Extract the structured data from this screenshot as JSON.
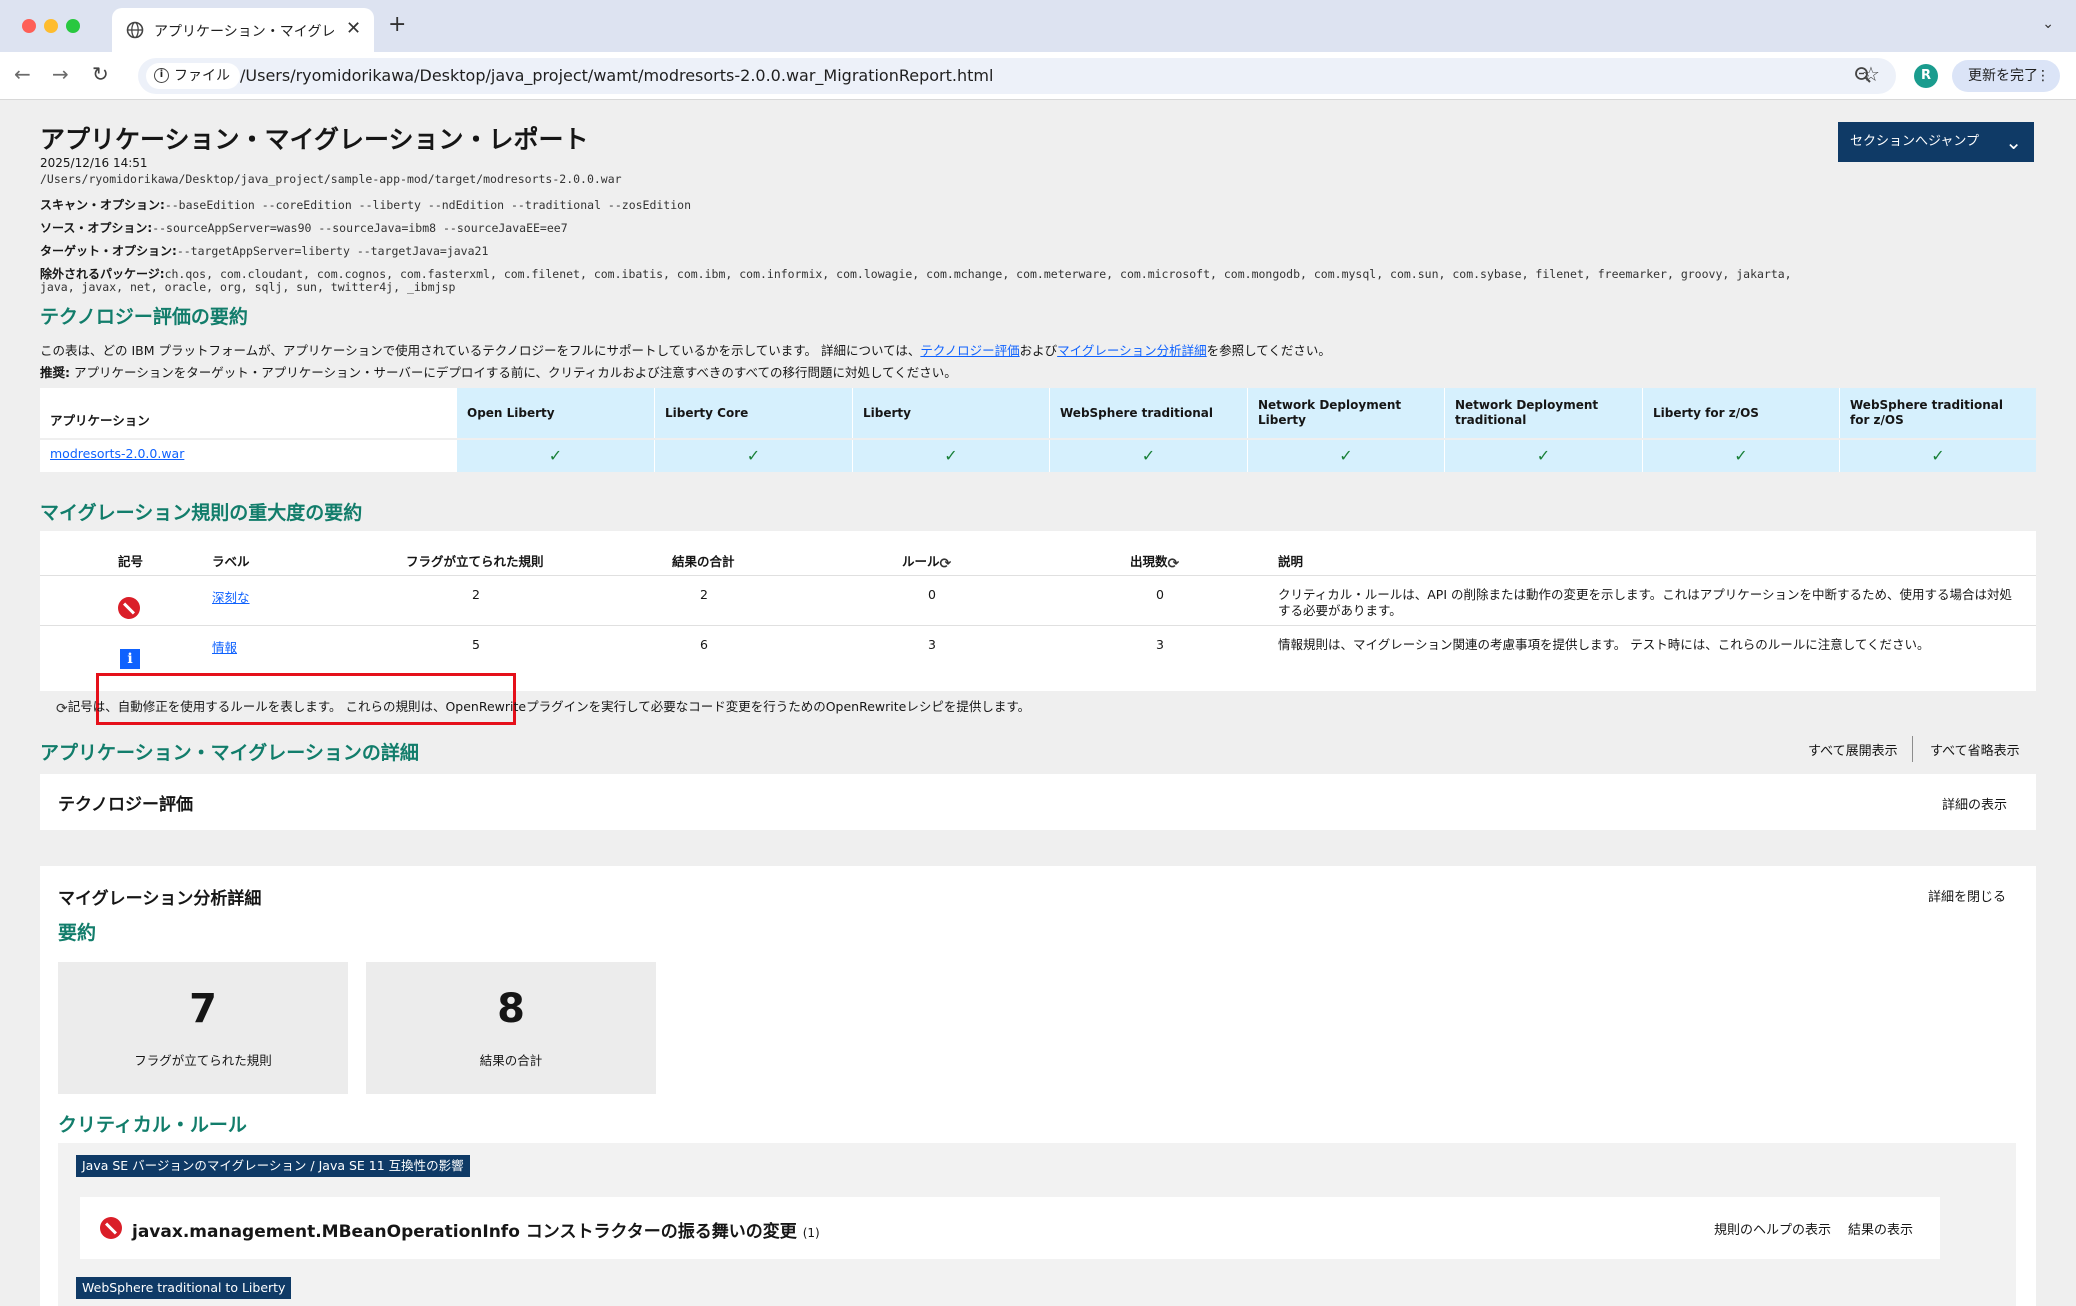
{
  "browser": {
    "tab_title": "アプリケーション・マイグレーシ",
    "url_scheme_label": "ファイル",
    "url": "/Users/ryomidorikawa/Desktop/java_project/wamt/modresorts-2.0.0.war_MigrationReport.html",
    "profile_initial": "R",
    "update_label": "更新を完了"
  },
  "report": {
    "title": "アプリケーション・マイグレーション・レポート",
    "jump_label": "セクションへジャンプ",
    "date": "2025/12/16 14:51",
    "path": "/Users/ryomidorikawa/Desktop/java_project/sample-app-mod/target/modresorts-2.0.0.war",
    "scan_options_label": "スキャン・オプション:",
    "scan_options": "--baseEdition --coreEdition --liberty --ndEdition --traditional --zosEdition",
    "source_options_label": "ソース・オプション:",
    "source_options": "--sourceAppServer=was90 --sourceJava=ibm8 --sourceJavaEE=ee7",
    "target_options_label": "ターゲット・オプション:",
    "target_options": "--targetAppServer=liberty --targetJava=java21",
    "excluded_label": "除外されるパッケージ:",
    "excluded_line1": "ch.qos, com.cloudant, com.cognos, com.fasterxml, com.filenet, com.ibatis, com.ibm, com.informix, com.lowagie, com.mchange, com.meterware, com.microsoft, com.mongodb, com.mysql, com.sun, com.sybase, filenet, freemarker, groovy, jakarta,",
    "excluded_line2": "java, javax, net, oracle, org, sqlj, sun, twitter4j, _ibmjsp"
  },
  "tech_summary": {
    "heading": "テクノロジー評価の要約",
    "desc_prefix": "この表は、どの IBM プラットフォームが、アプリケーションで使用されているテクノロジーをフルにサポートしているかを示しています。 詳細については、",
    "desc_link1": "テクノロジー評価",
    "desc_mid": "および",
    "desc_link2": "マイグレーション分析詳細",
    "desc_suffix": "を参照してください。",
    "reco_label": "推奨:",
    "reco_text": " アプリケーションをターゲット・アプリケーション・サーバーにデプロイする前に、クリティカルおよび注意すべきのすべての移行問題に対処してください。",
    "app_header": "アプリケーション",
    "app_name": "modresorts-2.0.0.war",
    "platforms": [
      {
        "name": "Open Liberty",
        "check": "✓"
      },
      {
        "name": "Liberty Core",
        "check": "✓"
      },
      {
        "name": "Liberty",
        "check": "✓"
      },
      {
        "name": "WebSphere traditional",
        "check": "✓"
      },
      {
        "name": "Network Deployment Liberty",
        "check": "✓"
      },
      {
        "name": "Network Deployment traditional",
        "check": "✓"
      },
      {
        "name": "Liberty for z/OS",
        "check": "✓"
      },
      {
        "name": "WebSphere traditional for z/OS",
        "check": "✓"
      }
    ]
  },
  "severity": {
    "heading": "マイグレーション規則の重大度の要約",
    "headers": {
      "symbol": "記号",
      "label": "ラベル",
      "flagged": "フラグが立てられた規則",
      "total": "結果の合計",
      "rules": "ルール",
      "occurrences": "出現数",
      "description": "説明"
    },
    "rows": [
      {
        "label": "深刻な",
        "flagged": "2",
        "total": "2",
        "rules": "0",
        "occurrences": "0",
        "description": "クリティカル・ルールは、API の削除または動作の変更を示します。これはアプリケーションを中断するため、使用する場合は対処する必要があります。"
      },
      {
        "label": "情報",
        "flagged": "5",
        "total": "6",
        "rules": "3",
        "occurrences": "3",
        "description": "情報規則は、マイグレーション関連の考慮事項を提供します。 テスト時には、これらのルールに注意してください。"
      }
    ],
    "autofix_note": "記号は、自動修正を使用するルールを表します。 これらの規則は、OpenRewriteプラグインを実行して必要なコード変更を行うためのOpenRewriteレシピを提供します。"
  },
  "details": {
    "heading": "アプリケーション・マイグレーションの詳細",
    "expand_all": "すべて展開表示",
    "collapse_all": "すべて省略表示",
    "tech_eval_title": "テクノロジー評価",
    "tech_eval_link": "詳細の表示",
    "analysis_title": "マイグレーション分析詳細",
    "analysis_link": "詳細を閉じる",
    "summary_heading": "要約",
    "stats": [
      {
        "value": "7",
        "label": "フラグが立てられた規則"
      },
      {
        "value": "8",
        "label": "結果の合計"
      }
    ],
    "critical_heading": "クリティカル・ルール",
    "tag1": "Java SE バージョンのマイグレーション / Java SE 11 互換性の影響",
    "rule_title": "javax.management.MBeanOperationInfo コンストラクターの振る舞いの変更",
    "rule_count": "(1)",
    "rule_help": "規則のヘルプの表示",
    "rule_results": "結果の表示",
    "tag2": "WebSphere traditional to Liberty"
  }
}
